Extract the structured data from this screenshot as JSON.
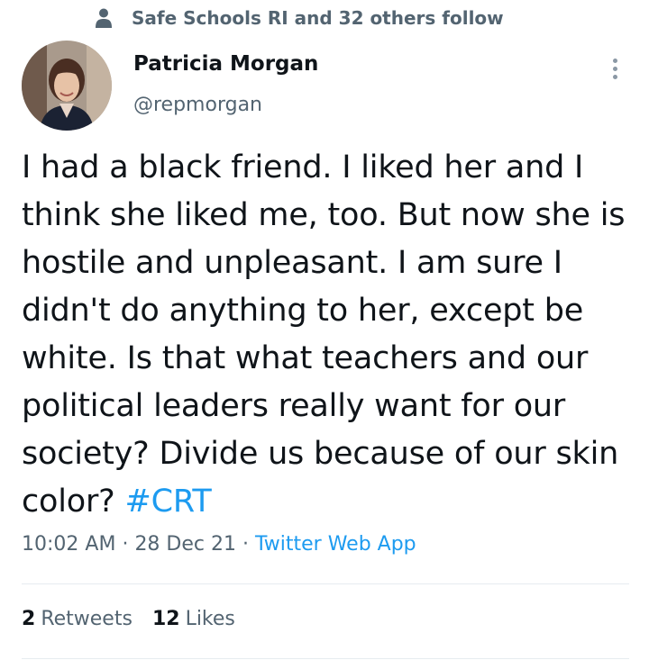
{
  "social_context": {
    "icon": "person-icon",
    "text": "Safe Schools RI and 32 others follow"
  },
  "author": {
    "name": "Patricia Morgan",
    "handle": "@repmorgan",
    "avatar": "avatar-photo"
  },
  "tweet": {
    "text": "I had a black friend. I liked her and I think she liked me, too. But now she is hostile and unpleasant. I am sure I didn't do anything to her, except be white. Is that what teachers and our political leaders really want for our society?  Divide us because of our skin color? ",
    "hashtag": "#CRT",
    "time": "10:02 AM",
    "date": "28 Dec 21",
    "separator": "·",
    "source": "Twitter Web App"
  },
  "stats": {
    "retweets_count": "2",
    "retweets_label": "Retweets",
    "likes_count": "12",
    "likes_label": "Likes"
  },
  "colors": {
    "accent": "#1d9bf0",
    "secondary_text": "#536471",
    "primary_text": "#0f1419"
  }
}
